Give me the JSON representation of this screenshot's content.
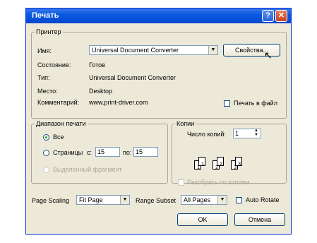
{
  "window": {
    "title": "Печать"
  },
  "titlebar_icons": [
    "help-icon",
    "close-icon"
  ],
  "printer": {
    "group_label": "Принтер",
    "name_label": "Имя:",
    "name_value": "Universal Document Converter",
    "properties_button": "Свойства...",
    "status_label": "Состояние:",
    "status_value": "Готов",
    "type_label": "Тип:",
    "type_value": "Universal Document Converter",
    "location_label": "Место:",
    "location_value": "Desktop",
    "comment_label": "Комментарий:",
    "comment_value": "www.print-driver.com",
    "print_to_file_label": "Печать в файл",
    "print_to_file_checked": false
  },
  "range": {
    "group_label": "Диапазон печати",
    "all_label": "Все",
    "pages_label": "Страницы",
    "from_label": "с:",
    "from_value": "15",
    "to_label": "по:",
    "to_value": "15",
    "selection_label": "Выделенный фрагмент",
    "selected": "all"
  },
  "copies": {
    "group_label": "Копии",
    "count_label": "Число копий:",
    "count_value": "1",
    "collate_label": "Разобрать по копиям",
    "collate_checked": false,
    "preview_pages": [
      "1",
      "1",
      "2",
      "2",
      "3",
      "3"
    ]
  },
  "bottom": {
    "page_scaling_label": "Page Scaling",
    "page_scaling_value": "Fit Page",
    "range_subset_label": "Range Subset",
    "range_subset_value": "All Pages",
    "auto_rotate_label": "Auto Rotate",
    "auto_rotate_checked": false
  },
  "buttons": {
    "ok": "OK",
    "cancel": "Отмена"
  },
  "colors": {
    "titlebar": "#0a5ae0",
    "dialog_bg": "#ece9d8",
    "close": "#c8451e",
    "radio_dot": "#21a121"
  }
}
